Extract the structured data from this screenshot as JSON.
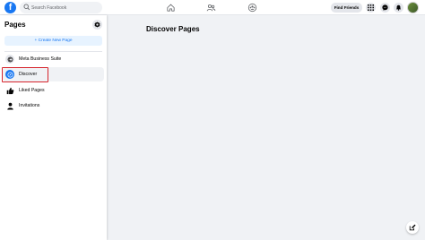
{
  "topbar": {
    "logo_letter": "f",
    "search_placeholder": "Search Facebook",
    "nav_icons": [
      "home-icon",
      "friends-icon",
      "groups-icon"
    ],
    "find_friends_label": "Find Friends",
    "right_icons": [
      "menu-grid-icon",
      "messenger-icon",
      "bell-icon"
    ]
  },
  "sidebar": {
    "title": "Pages",
    "create_label": "+ Create New Page",
    "items": [
      {
        "label": "Meta Business Suite",
        "icon": "meta-business-icon"
      },
      {
        "label": "Discover",
        "icon": "compass-icon"
      },
      {
        "label": "Liked Pages",
        "icon": "thumbs-up-icon"
      },
      {
        "label": "Invitations",
        "icon": "person-icon"
      }
    ]
  },
  "main": {
    "title": "Discover Pages"
  },
  "colors": {
    "brand": "#1877f2",
    "highlight": "#d6242c",
    "background": "#f0f2f5"
  }
}
